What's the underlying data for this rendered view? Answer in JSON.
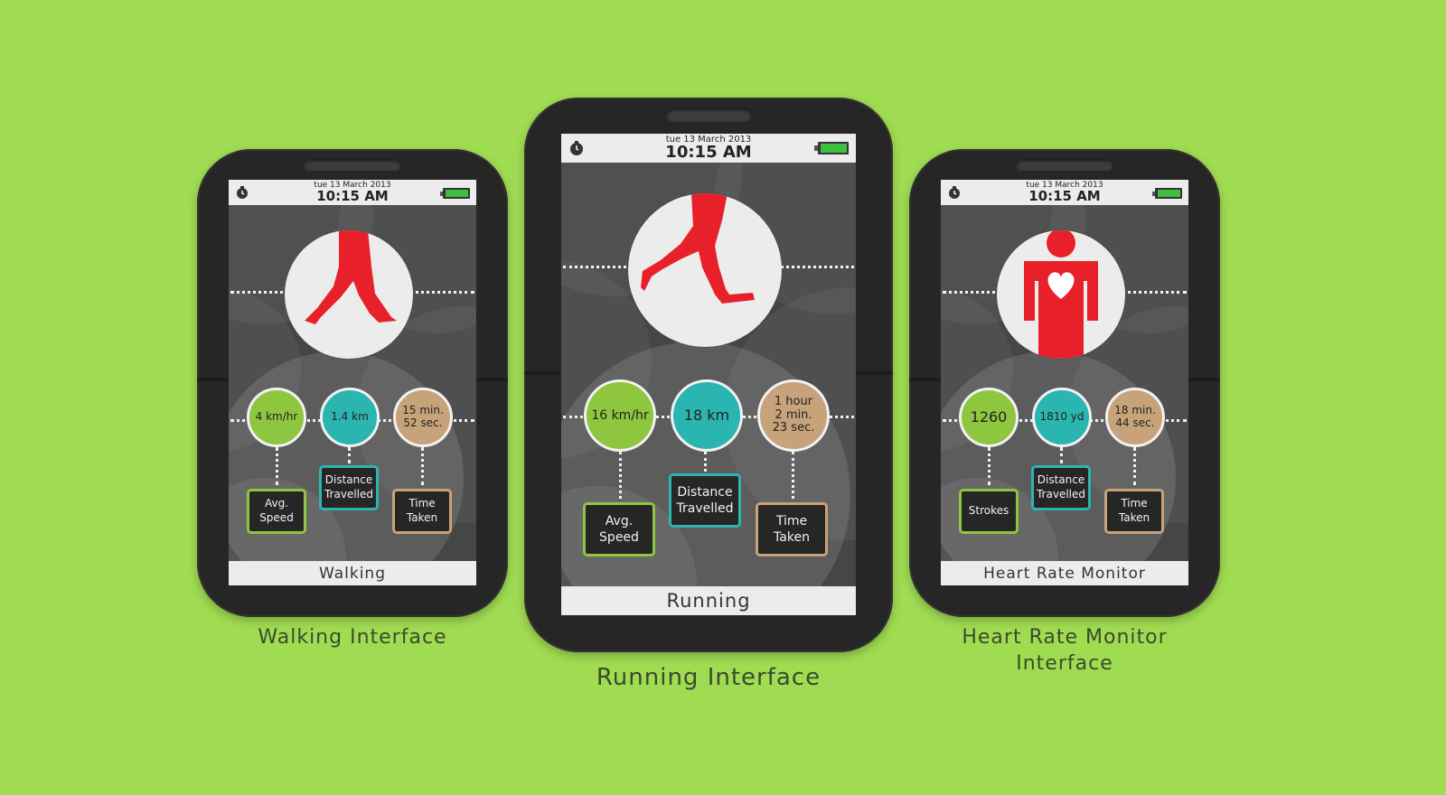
{
  "status": {
    "date": "tue 13 March 2013",
    "time": "10:15 AM"
  },
  "colors": {
    "background": "#a0dc52",
    "speed": "#8ec63f",
    "distance": "#2bb5b0",
    "time": "#c8a27a",
    "figure": "#e8202a"
  },
  "phones": {
    "walking": {
      "hero_icon": "walking-legs-icon",
      "metrics": {
        "speed": "4 km/hr",
        "distance": "1.4 km",
        "time_line1": "15 min.",
        "time_line2": "52 sec."
      },
      "labels": {
        "speed_line1": "Avg.",
        "speed_line2": "Speed",
        "distance_line1": "Distance",
        "distance_line2": "Travelled",
        "time_line1": "Time",
        "time_line2": "Taken"
      },
      "footer": "Walking",
      "caption": "Walking Interface"
    },
    "running": {
      "hero_icon": "running-legs-icon",
      "metrics": {
        "speed": "16 km/hr",
        "distance": "18 km",
        "time_line1": "1 hour",
        "time_line2": "2 min.",
        "time_line3": "23 sec."
      },
      "labels": {
        "speed_line1": "Avg.",
        "speed_line2": "Speed",
        "distance_line1": "Distance",
        "distance_line2": "Travelled",
        "time_line1": "Time",
        "time_line2": "Taken"
      },
      "footer": "Running",
      "caption": "Running Interface"
    },
    "heart": {
      "hero_icon": "heart-person-icon",
      "metrics": {
        "strokes": "1260",
        "distance": "1810 yd",
        "time_line1": "18 min.",
        "time_line2": "44 sec."
      },
      "labels": {
        "strokes": "Strokes",
        "distance_line1": "Distance",
        "distance_line2": "Travelled",
        "time_line1": "Time",
        "time_line2": "Taken"
      },
      "footer": "Heart Rate Monitor",
      "caption_line1": "Heart Rate Monitor",
      "caption_line2": "Interface"
    }
  }
}
